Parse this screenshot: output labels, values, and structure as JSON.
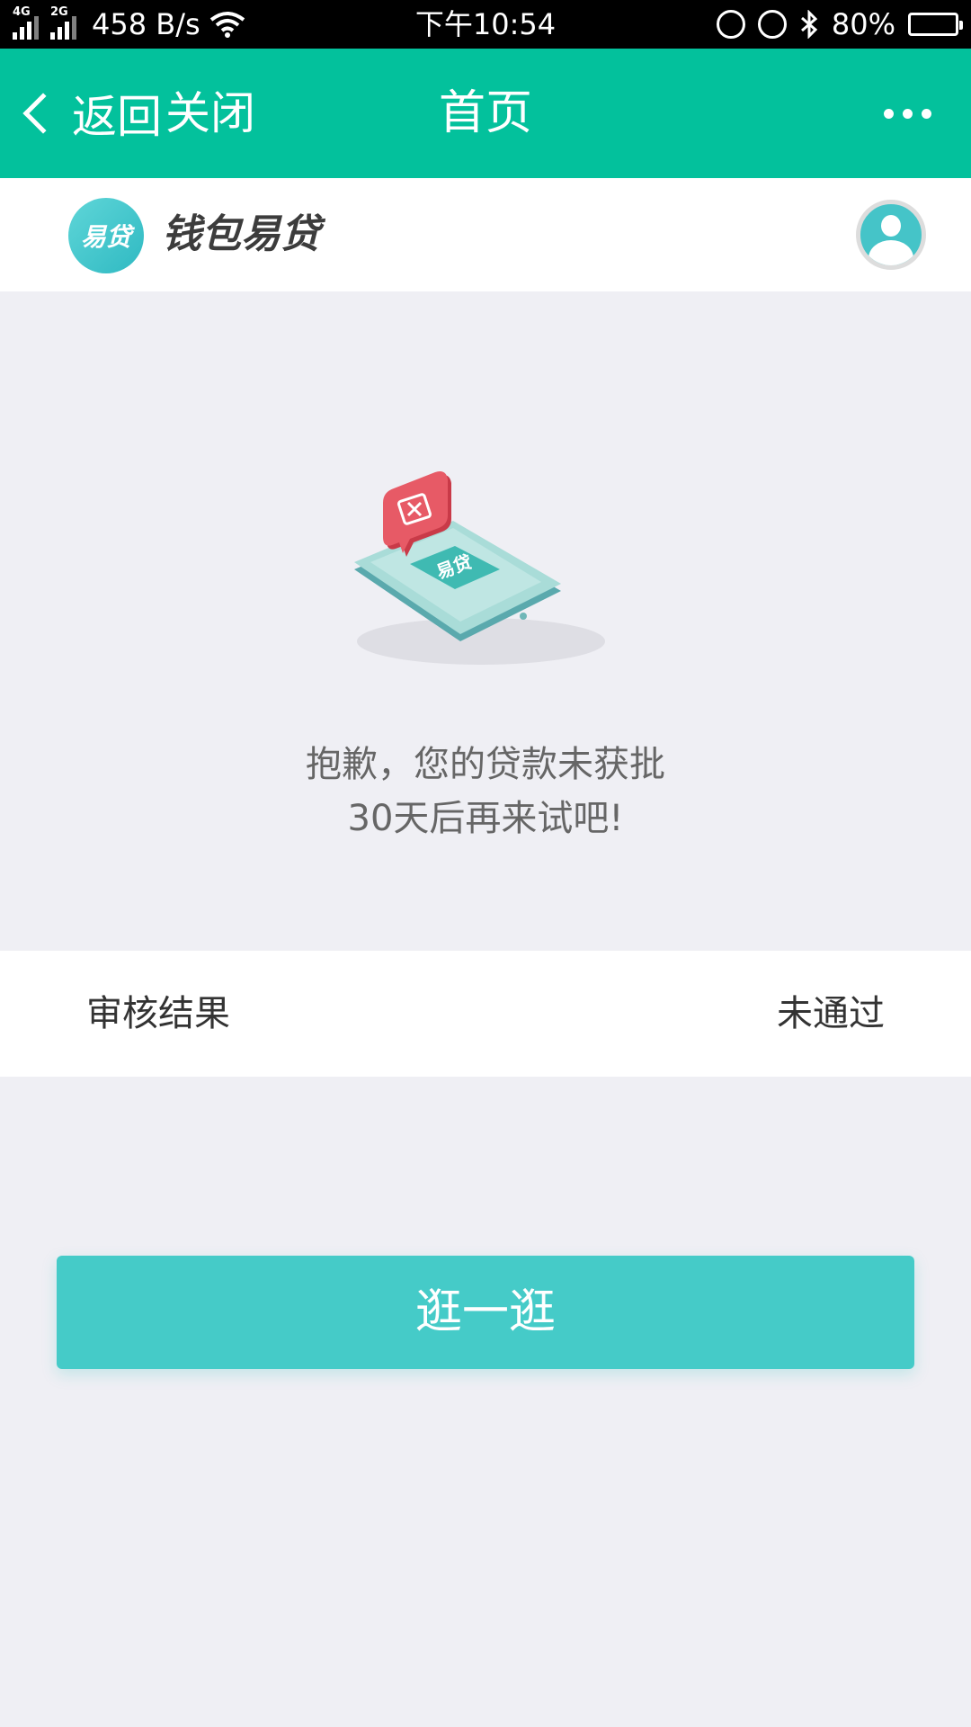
{
  "status_bar": {
    "net1": "4G",
    "net2": "2G",
    "speed": "458 B/s",
    "time": "下午10:54",
    "battery": "80%",
    "battery_level": 0.8,
    "icons": [
      "signal-icon",
      "wifi-icon",
      "lock-rotation-icon",
      "alarm-icon",
      "bluetooth-icon",
      "battery-icon"
    ]
  },
  "nav": {
    "back_label": "返回",
    "close_label": "关闭",
    "title": "首页",
    "accent": "#03c19c"
  },
  "brand": {
    "logo_text": "易贷",
    "name": "钱包易贷"
  },
  "illustration": {
    "phone_label": "易贷"
  },
  "message": {
    "line1": "抱歉，您的贷款未获批",
    "line2": "30天后再来试吧!"
  },
  "result": {
    "label": "审核结果",
    "value": "未通过"
  },
  "button": {
    "label": "逛一逛",
    "color": "#45cbc8"
  }
}
